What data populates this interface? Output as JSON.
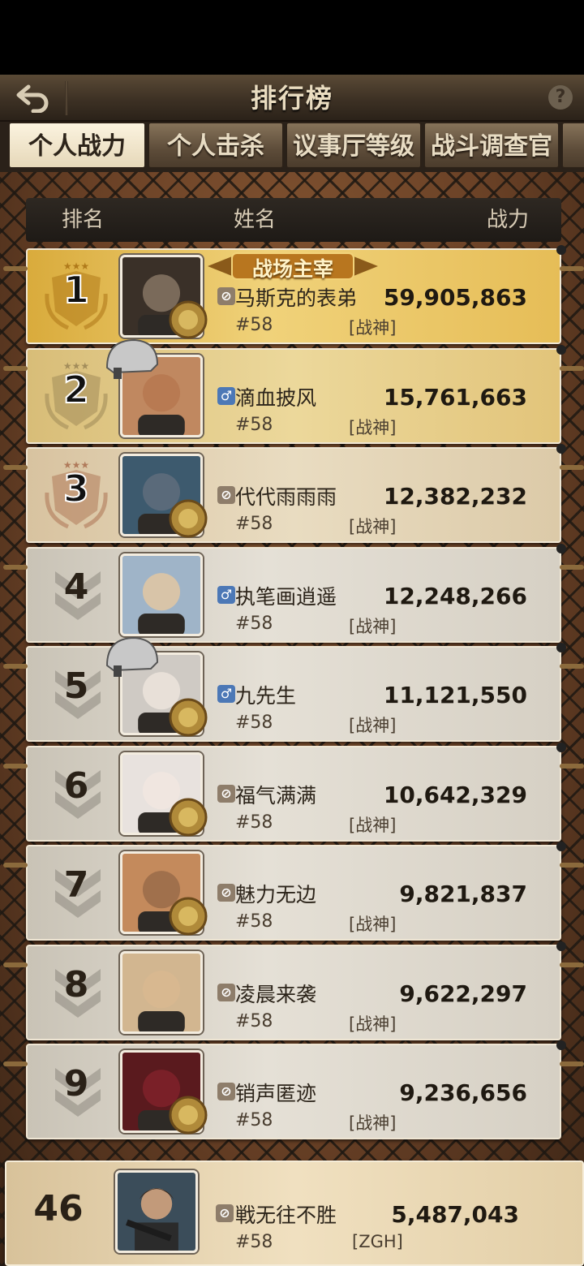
{
  "header": {
    "title": "排行榜",
    "help_label": "?"
  },
  "tabs": [
    {
      "label": "个人战力",
      "active": true
    },
    {
      "label": "个人击杀",
      "active": false
    },
    {
      "label": "议事厅等级",
      "active": false
    },
    {
      "label": "战斗调查官",
      "active": false
    }
  ],
  "columns": {
    "rank": "排名",
    "name": "姓名",
    "power": "战力"
  },
  "rows": [
    {
      "rank": "1",
      "name": "马斯克的表弟",
      "gender": "hidden",
      "server": "#58",
      "alliance": "[战神]",
      "power": "59,905,863",
      "title": "战场主宰",
      "style": "gold"
    },
    {
      "rank": "2",
      "name": "滴血披风",
      "gender": "male",
      "server": "#58",
      "alliance": "[战神]",
      "power": "15,761,663",
      "style": "gold2"
    },
    {
      "rank": "3",
      "name": "代代雨雨雨",
      "gender": "hidden",
      "server": "#58",
      "alliance": "[战神]",
      "power": "12,382,232",
      "style": "bronze"
    },
    {
      "rank": "4",
      "name": "执笔画逍遥",
      "gender": "male",
      "server": "#58",
      "alliance": "[战神]",
      "power": "12,248,266",
      "style": "plain"
    },
    {
      "rank": "5",
      "name": "九先生",
      "gender": "male",
      "server": "#58",
      "alliance": "[战神]",
      "power": "11,121,550",
      "style": "plain"
    },
    {
      "rank": "6",
      "name": "福气满满",
      "gender": "hidden",
      "server": "#58",
      "alliance": "[战神]",
      "power": "10,642,329",
      "style": "plain"
    },
    {
      "rank": "7",
      "name": "魅力无边",
      "gender": "hidden",
      "server": "#58",
      "alliance": "[战神]",
      "power": "9,821,837",
      "style": "plain"
    },
    {
      "rank": "8",
      "name": "凌晨来袭",
      "gender": "hidden",
      "server": "#58",
      "alliance": "[战神]",
      "power": "9,622,297",
      "style": "plain"
    },
    {
      "rank": "9",
      "name": "销声匿迹",
      "gender": "hidden",
      "server": "#58",
      "alliance": "[战神]",
      "power": "9,236,656",
      "style": "plain"
    }
  ],
  "self": {
    "rank": "46",
    "name": "戦无往不胜",
    "gender": "hidden",
    "server": "#58",
    "alliance": "[ZGH]",
    "power": "5,487,043"
  },
  "gender_symbols": {
    "male": "♂",
    "hidden": "⊘"
  },
  "icons": [
    "back-arrow-icon",
    "help-icon",
    "rank-emblem-icon",
    "helmet-icon",
    "badge-icon",
    "gender-icon"
  ],
  "colors": {
    "gold_row": "#f0d27a",
    "plain_row": "#e5e0d6",
    "header_bg": "#3d3124",
    "active_tab": "#fbf3df"
  }
}
